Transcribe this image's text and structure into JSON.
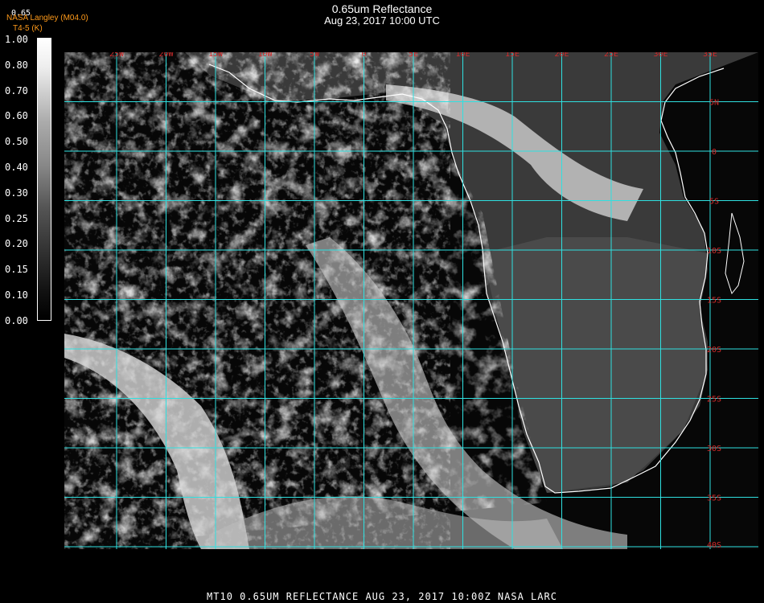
{
  "header": {
    "title": "0.65um Reflectance",
    "subtitle": "Aug 23, 2017 10:00 UTC",
    "credit_line1": "NASA Langley (M04.0)",
    "credit_line2": "T4-5 (K)",
    "top_tick": "0.65"
  },
  "colorbar": {
    "labels": [
      "1.00",
      "0.80",
      "0.70",
      "0.60",
      "0.50",
      "0.40",
      "0.30",
      "0.25",
      "0.20",
      "0.15",
      "0.10",
      "0.00"
    ]
  },
  "map": {
    "lon_labels": [
      "25W",
      "20W",
      "15W",
      "10W",
      "5W",
      "0",
      "5E",
      "10E",
      "15E",
      "20E",
      "25E",
      "30E",
      "35E"
    ],
    "lat_labels": [
      "5N",
      "0",
      "5S",
      "10S",
      "15S",
      "20S",
      "25S",
      "30S",
      "35S",
      "40S"
    ],
    "grid_color": "#2fe0e0",
    "label_color": "#d42a2a",
    "coast_color": "#ffffff"
  },
  "footer": {
    "text": "MT10  0.65UM REFLECTANCE   AUG 23, 2017 10:00Z   NASA LARC"
  }
}
